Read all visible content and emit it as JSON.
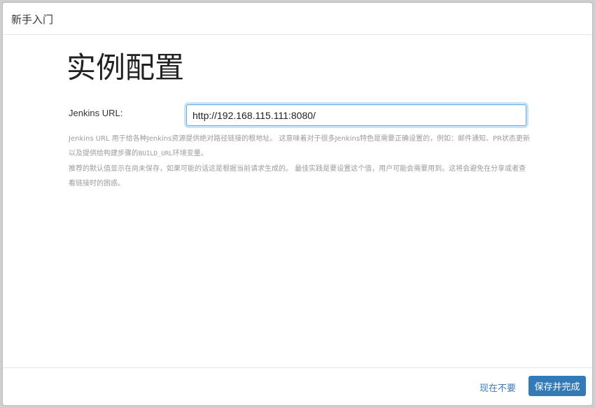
{
  "dialog": {
    "title": "新手入门"
  },
  "page": {
    "title": "实例配置"
  },
  "form": {
    "url_label": "Jenkins URL:",
    "url_value": "http://192.168.115.111:8080/"
  },
  "help": {
    "para1_text": "Jenkins URL 用于给各种Jenkins资源提供绝对路径链接的根地址。 这意味着对于很多Jenkins特色是需要正确设置的，例如：邮件通知、PR状态更新以及提供给构建步骤的",
    "para1_code": "BUILD_URL",
    "para1_end": "环境变量。",
    "para2_a": "推荐的默认值显示在",
    "para2_emph": "尚未保存",
    "para2_b": "，如果可能的话这是根据当前请求生成的。 最佳实践是要设置这个值，用户可能会需要用到。这将会避免在分享或者查看链接时的困惑。"
  },
  "footer": {
    "skip_label": "现在不要",
    "save_label": "保存并完成"
  },
  "colors": {
    "primary": "#337ab7",
    "link": "#3d7ab8",
    "focus_ring": "#66afe9",
    "help_text": "#9b9b9b"
  }
}
